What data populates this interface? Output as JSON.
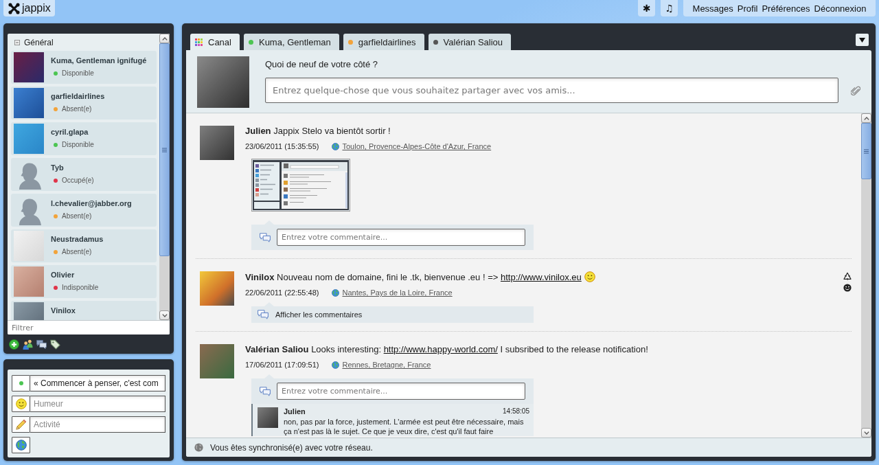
{
  "top_bar": {
    "logo": "jappix",
    "icon_buttons": [
      "✱",
      "♫"
    ],
    "links": [
      "Messages",
      "Profil",
      "Préférences",
      "Déconnexion"
    ]
  },
  "roster": {
    "groups": [
      {
        "name": "Général",
        "expanded": true,
        "contacts": [
          {
            "name": "Kuma, Gentleman ignifugé",
            "status": "Disponible",
            "color": "#4cc552",
            "custom_avatar": true
          },
          {
            "name": "garfieldairlines",
            "status": "Absent(e)",
            "color": "#f2a33a",
            "custom_avatar": true
          },
          {
            "name": "cyril.glapa",
            "status": "Disponible",
            "color": "#4cc552",
            "custom_avatar": true
          },
          {
            "name": "Tyb",
            "status": "Occupé(e)",
            "color": "#e0354a",
            "custom_avatar": false
          },
          {
            "name": "l.chevalier@jabber.org",
            "status": "Absent(e)",
            "color": "#f2a33a",
            "custom_avatar": false
          },
          {
            "name": "Neustradamus",
            "status": "Absent(e)",
            "color": "#f2a33a",
            "custom_avatar": true
          },
          {
            "name": "Olivier",
            "status": "Indisponible",
            "color": "#e0354a",
            "custom_avatar": true
          },
          {
            "name": "Vinilox",
            "custom_avatar": true
          }
        ]
      }
    ],
    "filter": {
      "placeholder": "Filtrer"
    }
  },
  "status_panel": {
    "presence": {
      "color": "#4cc552",
      "message": "« Commencer à penser, c'est com"
    },
    "mood": {
      "placeholder": "Humeur"
    },
    "activity": {
      "placeholder": "Activité"
    }
  },
  "tabs": [
    {
      "kind": "channel",
      "label": "Canal",
      "selected": true
    },
    {
      "kind": "chat",
      "label": "Kuma, Gentleman",
      "color": "#4cc552",
      "selected": false
    },
    {
      "kind": "chat",
      "label": "garfieldairlines",
      "color": "#f2a33a",
      "selected": false
    },
    {
      "kind": "chat",
      "label": "Valérian Saliou",
      "color": "#555555",
      "selected": false
    }
  ],
  "composer": {
    "prompt": "Quoi de neuf de votre côté ?",
    "placeholder": "Entrez quelque-chose que vous souhaitez partager avec vos amis..."
  },
  "posts": [
    {
      "author": "Julien",
      "body": [
        {
          "kind": "text",
          "text": "Jappix Stelo va bientôt sortir !"
        }
      ],
      "date": "23/06/2011 (15:35:55)",
      "location": "Toulon, Provence-Alpes-Côte d'Azur, France",
      "has_attachment": true,
      "show_actions": false,
      "comments": {
        "kind": "form",
        "placeholder": "Entrez votre commentaire..."
      }
    },
    {
      "author": "Vinilox",
      "body": [
        {
          "kind": "text",
          "text": "Nouveau nom de domaine, fini le .tk, bienvenue .eu ! => "
        },
        {
          "kind": "link",
          "text": "http://www.vinilox.eu"
        },
        {
          "kind": "smiley"
        }
      ],
      "date": "22/06/2011 (22:55:48)",
      "location": "Nantes, Pays de la Loire, France",
      "has_attachment": false,
      "show_actions": true,
      "comments": {
        "kind": "collapsed",
        "label": "Afficher les commentaires"
      }
    },
    {
      "author": "Valérian Saliou",
      "body": [
        {
          "kind": "text",
          "text": "Looks interesting: "
        },
        {
          "kind": "link",
          "text": "http://www.happy-world.com/"
        },
        {
          "kind": "text",
          "text": " I subsribed to the release notification!"
        }
      ],
      "date": "17/06/2011 (17:09:51)",
      "location": "Rennes, Bretagne, France",
      "has_attachment": false,
      "show_actions": false,
      "comments": {
        "kind": "form",
        "placeholder": "Entrez votre commentaire...",
        "items": [
          {
            "author": "Julien",
            "time": "14:58:05",
            "text": "non, pas par la force, justement. L'armée est peut être nécessaire, mais ça n'est pas là le sujet. Ce que je veux dire, c'est qu'il faut faire"
          }
        ]
      }
    }
  ],
  "footer": {
    "text": "Vous êtes synchronisé(e) avec votre réseau."
  }
}
